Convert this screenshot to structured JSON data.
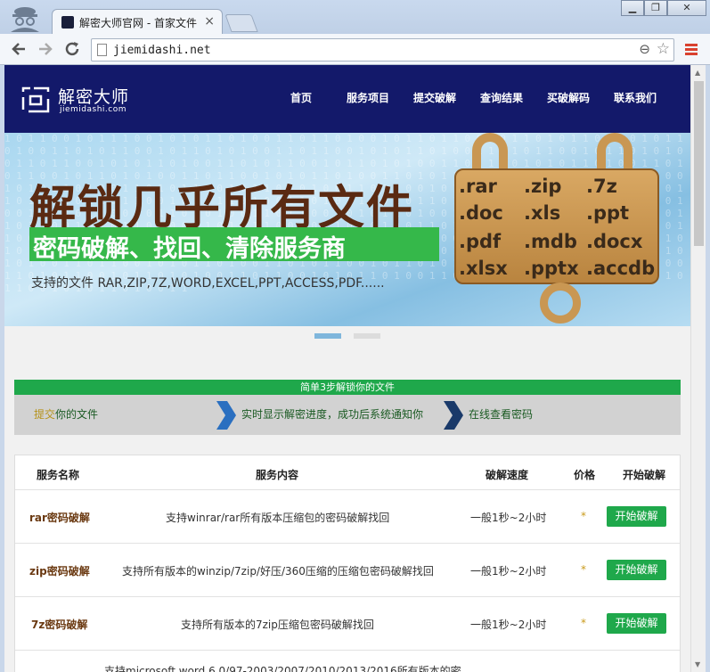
{
  "browser": {
    "tab_title": "解密大师官网 - 首家文件",
    "tab_close": "×",
    "url": "jiemidashi.net",
    "window_buttons": [
      "▁",
      "❐",
      "✕"
    ]
  },
  "header": {
    "logo_name": "解密大师",
    "logo_domain": "jiemidashi.com",
    "nav": [
      "首页",
      "服务项目",
      "提交破解",
      "查询结果",
      "买破解码",
      "联系我们"
    ]
  },
  "banner": {
    "headline": "解锁几乎所有文件",
    "subheadline": "密码破解、找回、清除服务商",
    "support_text": "支持的文件 RAR,ZIP,7Z,WORD,EXCEL,PPT,ACCESS,PDF......",
    "extensions": [
      ".rar",
      ".zip",
      ".7z",
      ".doc",
      ".xls",
      ".ppt",
      ".pdf",
      ".mdb",
      ".docx",
      ".xlsx",
      ".pptx",
      ".accdb"
    ]
  },
  "carousel": {
    "active_index": 0,
    "count": 2
  },
  "steps": {
    "title": "简单3步解锁你的文件",
    "step1_highlight": "提交",
    "step1_rest": "你的文件",
    "step2": "实时显示解密进度，成功后系统通知你",
    "step3": "在线查看密码"
  },
  "table": {
    "headers": [
      "服务名称",
      "服务内容",
      "破解速度",
      "价格",
      "开始破解"
    ],
    "rows": [
      {
        "name": "rar密码破解",
        "desc": "支持winrar/rar所有版本压缩包的密码破解找回",
        "speed": "一般1秒~2小时",
        "price": "*",
        "action": "开始破解"
      },
      {
        "name": "zip密码破解",
        "desc": "支持所有版本的winzip/7zip/好压/360压缩的压缩包密码破解找回",
        "speed": "一般1秒~2小时",
        "price": "*",
        "action": "开始破解"
      },
      {
        "name": "7z密码破解",
        "desc": "支持所有版本的7zip压缩包密码破解找回",
        "speed": "一般1秒~2小时",
        "price": "*",
        "action": "开始破解"
      },
      {
        "name": "",
        "desc": "支持microsoft word 6.0/97-2003/2007/2010/2013/2016所有版本的密",
        "speed": "",
        "price": "",
        "action": ""
      }
    ]
  },
  "colors": {
    "header_bg": "#13196a",
    "accent_green": "#1fa84b",
    "dot_active": "#7fb6dc",
    "dot_inactive": "#dcdcdc"
  }
}
